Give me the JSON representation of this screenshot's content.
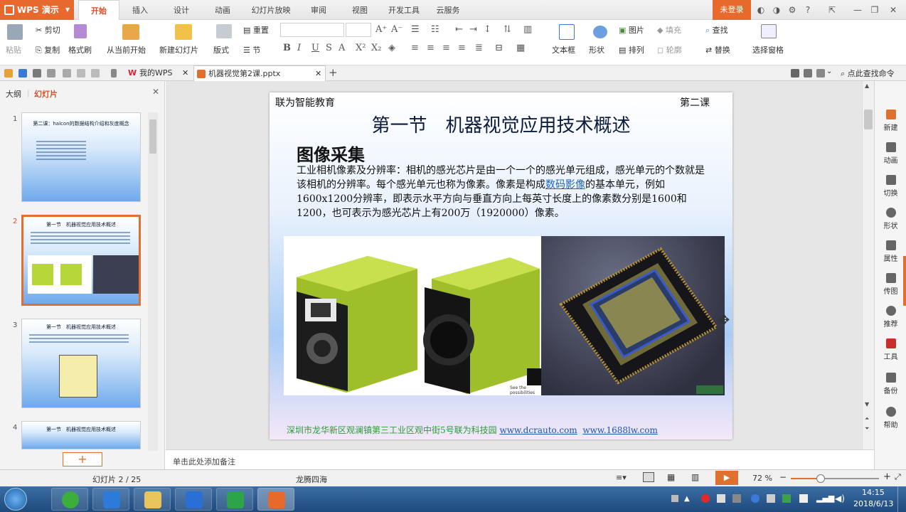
{
  "app": {
    "menu_label": "WPS 演示",
    "ribbon_tabs": [
      "开始",
      "插入",
      "设计",
      "动画",
      "幻灯片放映",
      "审阅",
      "视图",
      "开发工具",
      "云服务"
    ],
    "active_tab": "开始",
    "login_label": "未登录"
  },
  "ribbon": {
    "paste": "粘贴",
    "cut": "剪切",
    "copy": "复制",
    "format_painter": "格式刷",
    "from_current": "从当前开始",
    "new_slide": "新建幻灯片",
    "layout": "版式",
    "reset": "重置",
    "section": "节",
    "textbox": "文本框",
    "shape": "形状",
    "picture": "图片",
    "fill": "填充",
    "arrange": "排列",
    "outline": "轮廓",
    "find": "查找",
    "replace": "替换",
    "select_pane": "选择窗格"
  },
  "quickbar": {
    "tab_home": "我的WPS",
    "tab_doc": "机器视觉第2课.pptx",
    "search_cmd": "点此查找命令"
  },
  "left_pane": {
    "tab_outline": "大纲",
    "tab_slides": "幻灯片",
    "thumbs": [
      {
        "num": "1",
        "title": "第二课：halcon的数据结构介绍和灰度概念"
      },
      {
        "num": "2",
        "title": "第一节　机器视觉应用技术概述"
      },
      {
        "num": "3",
        "title": "第一节　机器视觉应用技术概述"
      },
      {
        "num": "4",
        "title": "第一节　机器视觉应用技术概述"
      }
    ]
  },
  "slide": {
    "header_left": "联为智能教育",
    "header_right": "第二课",
    "title": "第一节　机器视觉应用技术概述",
    "subtitle": "图像采集",
    "body_1": "工业相机像素及分辨率：相机的感光芯片是由一个一个的感光单元组成，感光单元的个数就是该相机的分辨率。每个感光单元也称为像素。像素是构成",
    "body_link": "数码影像",
    "body_2": "的基本单元，例如1600x1200分辨率，即表示水平方向与垂直方向上每英寸长度上的像素数分别是1600和1200，也可表示为感光芯片上有200万（1920000）像素。",
    "image_caption": "See the possibilities",
    "footer_text": "深圳市龙华新区观澜镇第三工业区观中街5号联为科技园",
    "footer_link1": "www.dcrauto.com",
    "footer_link2": "www.1688lw.com"
  },
  "side_panel": [
    "新建",
    "动画",
    "切换",
    "形状",
    "属性",
    "传图",
    "推荐",
    "工具",
    "备份",
    "帮助"
  ],
  "notes_placeholder": "单击此处添加备注",
  "status": {
    "slide_info": "幻灯片 2 / 25",
    "theme": "龙腾四海",
    "zoom": "72 %"
  },
  "taskbar": {
    "time": "14:15",
    "date": "2018/6/13"
  },
  "colors": {
    "accent": "#e7692e",
    "link": "#1a63c5",
    "footer_green": "#2e9a3a",
    "camera_green": "#b6d63a"
  }
}
